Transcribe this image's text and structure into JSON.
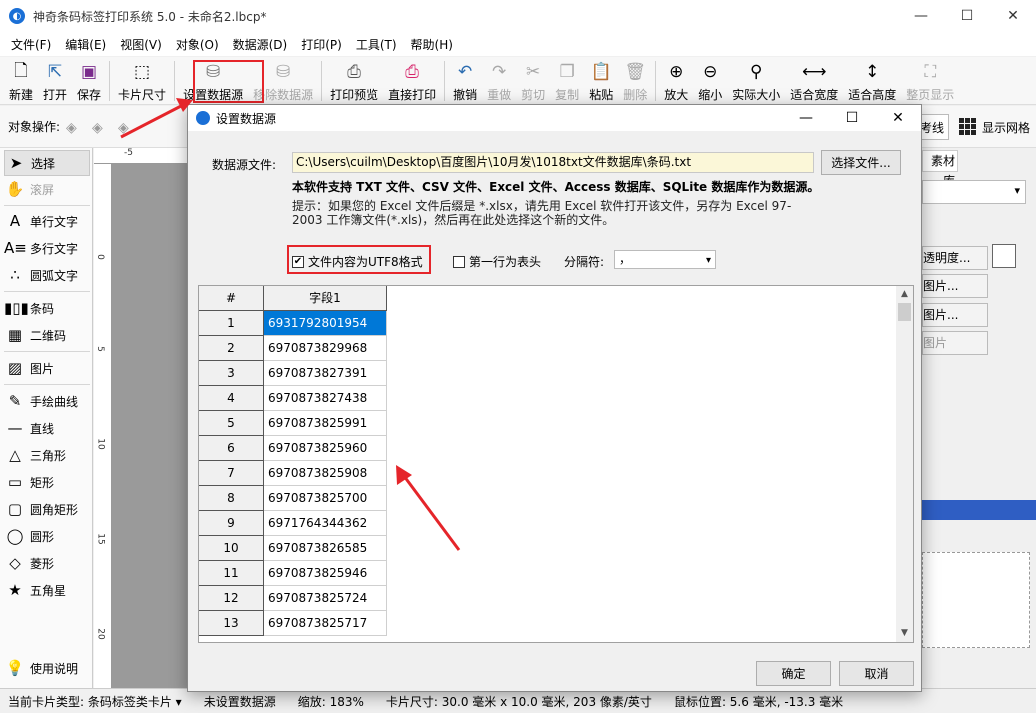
{
  "app": {
    "title": "神奇条码标签打印系统 5.0 - 未命名2.lbcp*",
    "icon": "app-logo-icon"
  },
  "window_controls": {
    "minimize": "—",
    "maximize": "☐",
    "close": "✕"
  },
  "menu": [
    "文件(F)",
    "编辑(E)",
    "视图(V)",
    "对象(O)",
    "数据源(D)",
    "打印(P)",
    "工具(T)",
    "帮助(H)"
  ],
  "toolbar": {
    "new": "新建",
    "open": "打开",
    "save": "保存",
    "card_size": "卡片尺寸",
    "set_datasource": "设置数据源",
    "remove_datasource": "移除数据源",
    "print_preview": "打印预览",
    "direct_print": "直接打印",
    "undo": "撤销",
    "redo": "重做",
    "cut": "剪切",
    "copy": "复制",
    "paste": "粘贴",
    "delete": "删除",
    "zoom_in": "放大",
    "zoom_out": "缩小",
    "actual_size": "实际大小",
    "fit_width": "适合宽度",
    "fit_height": "适合高度",
    "full_page": "整页显示"
  },
  "object_ops": {
    "label": "对象操作:",
    "ref_line": "考线",
    "show_grid": "显示网格"
  },
  "tools": {
    "select": "选择",
    "scroll": "滚屏",
    "single_text": "单行文字",
    "multi_text": "多行文字",
    "arc_text": "圆弧文字",
    "barcode": "条码",
    "qrcode": "二维码",
    "image": "图片",
    "freehand": "手绘曲线",
    "line": "直线",
    "triangle": "三角形",
    "rect": "矩形",
    "round_rect": "圆角矩形",
    "ellipse": "圆形",
    "diamond": "菱形",
    "star": "五角星",
    "help": "使用说明"
  },
  "ruler": {
    "top_label": "-5",
    "left_labels": [
      "0",
      "5",
      "10",
      "15",
      "20"
    ]
  },
  "right_panel": {
    "tab": "素材库",
    "btn_transparency": "透明度...",
    "btn_image1": "图片...",
    "btn_image2": "图片...",
    "btn_image3": "图片"
  },
  "status": {
    "card_type": "当前卡片类型:  条码标签类卡片 ▾",
    "datasource": "未设置数据源",
    "zoom": "缩放: 183%",
    "card_size": "卡片尺寸: 30.0 毫米 x 10.0 毫米, 203 像素/英寸",
    "cursor": "鼠标位置: 5.6 毫米,  -13.3 毫米"
  },
  "dialog": {
    "title": "设置数据源",
    "file_label": "数据源文件:",
    "file_path": "C:\\Users\\cuilm\\Desktop\\百度图片\\10月发\\1018txt文件数据库\\条码.txt",
    "choose_file": "选择文件...",
    "support_note": "本软件支持 TXT 文件、CSV 文件、Excel 文件、Access 数据库、SQLite 数据库作为数据源。",
    "hint": "提示：如果您的 Excel 文件后缀是 *.xlsx，请先用 Excel 软件打开该文件，另存为 Excel 97-2003 工作簿文件(*.xls)，然后再在此处选择这个新的文件。",
    "utf8_label": "文件内容为UTF8格式",
    "utf8_checked": "✔",
    "header_label": "第一行为表头",
    "separator_label": "分隔符:",
    "separator_value": "，",
    "ok": "确定",
    "cancel": "取消",
    "grid": {
      "headers": [
        "#",
        "字段1"
      ],
      "rows": [
        [
          "1",
          "6931792801954"
        ],
        [
          "2",
          "6970873829968"
        ],
        [
          "3",
          "6970873827391"
        ],
        [
          "4",
          "6970873827438"
        ],
        [
          "5",
          "6970873825991"
        ],
        [
          "6",
          "6970873825960"
        ],
        [
          "7",
          "6970873825908"
        ],
        [
          "8",
          "6970873825700"
        ],
        [
          "9",
          "6971764344362"
        ],
        [
          "10",
          "6970873826585"
        ],
        [
          "11",
          "6970873825946"
        ],
        [
          "12",
          "6970873825724"
        ],
        [
          "13",
          "6970873825717"
        ]
      ]
    }
  },
  "colors": {
    "accent_red": "#e5252a",
    "selection_blue": "#0078d7",
    "path_bg": "#fbf7d8"
  }
}
